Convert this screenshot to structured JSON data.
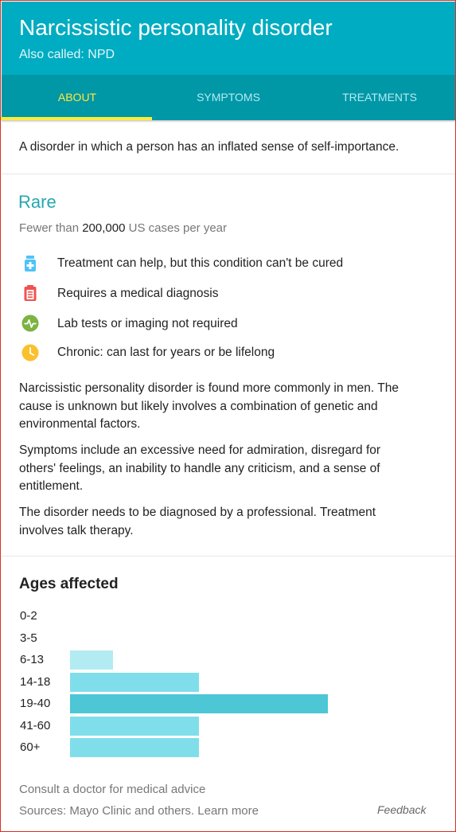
{
  "header": {
    "title": "Narcissistic personality disorder",
    "subtitle": "Also called: NPD",
    "background_color": "#00acc1"
  },
  "tabs": [
    {
      "label": "ABOUT",
      "active": true
    },
    {
      "label": "SYMPTOMS",
      "active": false
    },
    {
      "label": "TREATMENTS",
      "active": false
    }
  ],
  "summary": "A disorder in which a person has an inflated sense of self-importance.",
  "prevalence": {
    "label": "Rare",
    "prefix": "Fewer than",
    "count": "200,000",
    "suffix": "US cases per year"
  },
  "facts": [
    {
      "icon": "medicine-bottle-icon",
      "color": "#4fc3f7",
      "text": "Treatment can help, but this condition can't be cured"
    },
    {
      "icon": "clipboard-icon",
      "color": "#ef5350",
      "text": "Requires a medical diagnosis"
    },
    {
      "icon": "heartbeat-icon",
      "color": "#7cb342",
      "text": "Lab tests or imaging not required"
    },
    {
      "icon": "clock-icon",
      "color": "#fbc02d",
      "text": "Chronic: can last for years or be lifelong"
    }
  ],
  "paragraphs": [
    [
      "Narcissistic personality disorder is found more commonly in men. The",
      "cause is unknown but likely involves a combination of genetic and",
      "environmental factors."
    ],
    [
      "Symptoms include an excessive need for admiration, disregard for",
      "others' feelings, an inability to handle any criticism, and a sense of",
      "entitlement."
    ],
    [
      "The disorder needs to be diagnosed by a professional. Treatment",
      "involves talk therapy."
    ]
  ],
  "ages": {
    "title": "Ages affected",
    "max_level": 3,
    "groups": [
      {
        "label": "0-2",
        "level": 0,
        "color": "#b2ebf2"
      },
      {
        "label": "3-5",
        "level": 0,
        "color": "#b2ebf2"
      },
      {
        "label": "6-13",
        "level": 0.5,
        "color": "#b2ebf2"
      },
      {
        "label": "14-18",
        "level": 1.5,
        "color": "#80deea"
      },
      {
        "label": "19-40",
        "level": 3,
        "color": "#4dc6d6"
      },
      {
        "label": "41-60",
        "level": 1.5,
        "color": "#80deea"
      },
      {
        "label": "60+",
        "level": 1.5,
        "color": "#80deea"
      }
    ]
  },
  "footer": {
    "consult": "Consult a doctor for medical advice",
    "sources_prefix": "Sources: Mayo Clinic and others.",
    "learn_more": "Learn more",
    "feedback": "Feedback"
  }
}
